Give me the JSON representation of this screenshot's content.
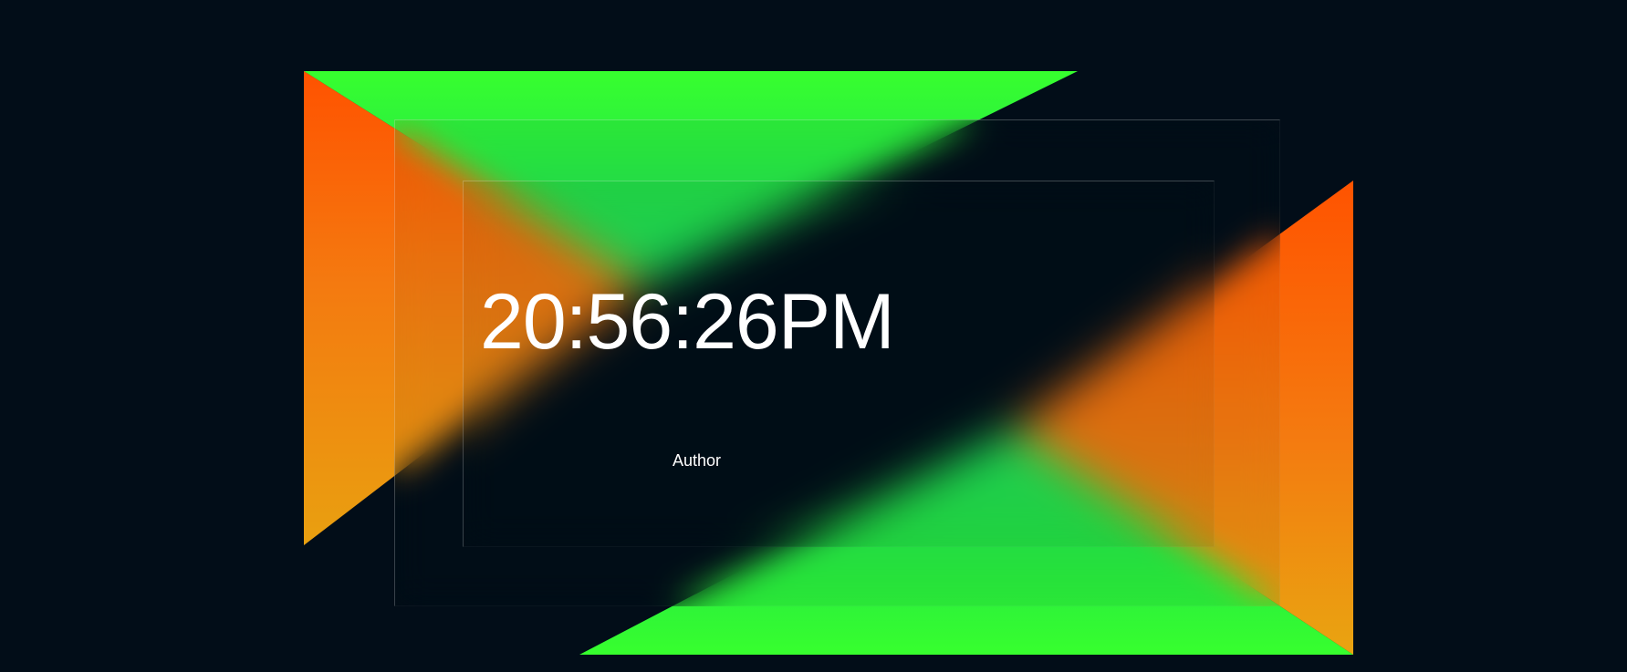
{
  "clock": {
    "time": "20:56:26PM"
  },
  "footer": {
    "author_label": "Author"
  },
  "colors": {
    "background": "#020d18",
    "orange": "#ff5a00",
    "amber": "#e9a010",
    "green": "#37ff2e",
    "teal_green": "#20e45c"
  }
}
